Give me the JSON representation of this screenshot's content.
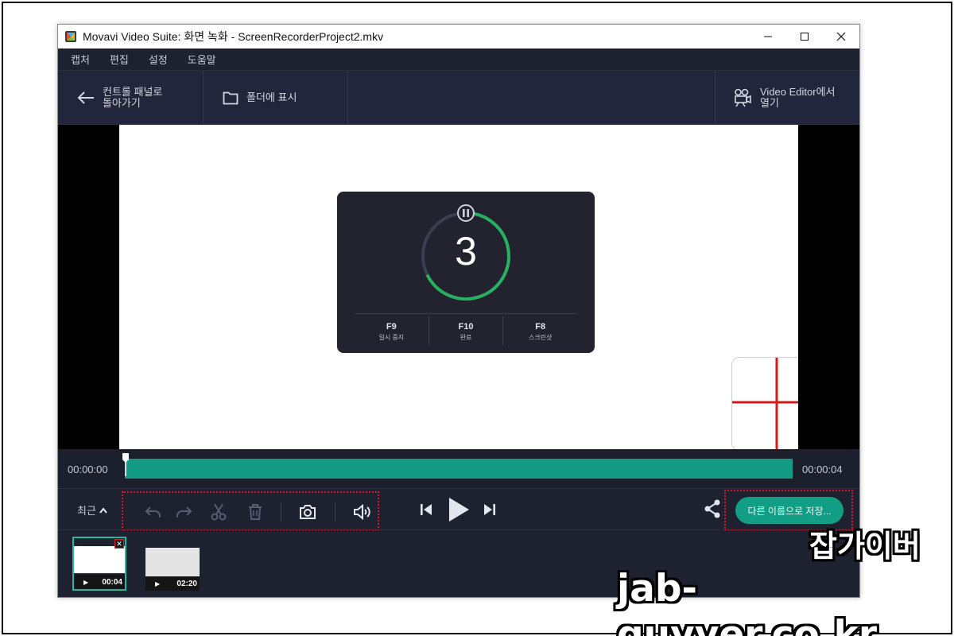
{
  "window": {
    "title": "Movavi Video Suite: 화면 녹화 - ScreenRecorderProject2.mkv"
  },
  "menu": [
    "캡처",
    "편집",
    "설정",
    "도움말"
  ],
  "toolbar": {
    "back_label_line1": "컨트롤 패널로",
    "back_label_line2": "돌아가기",
    "folder_label": "폴더에 표시",
    "editor_label_line1": "Video Editor에서",
    "editor_label_line2": "열기"
  },
  "countdown": {
    "number": "3",
    "hotkeys": [
      {
        "key": "F9",
        "label": "일시 중지"
      },
      {
        "key": "F10",
        "label": "완료"
      },
      {
        "key": "F8",
        "label": "스크린샷"
      }
    ]
  },
  "timeline": {
    "start_time": "00:00:00",
    "end_time": "00:00:04"
  },
  "controls": {
    "recent_label": "최근",
    "save_label": "다른 이름으로 저장..."
  },
  "clips": [
    {
      "duration": "00:04"
    },
    {
      "duration": "02:20"
    }
  ],
  "watermark": {
    "korean": "잡가이버",
    "url": "jab-guyver.co.kr"
  },
  "colors": {
    "accent": "#139b85",
    "highlight_border": "#e0102a",
    "countdown_ring": "#26b05f"
  }
}
